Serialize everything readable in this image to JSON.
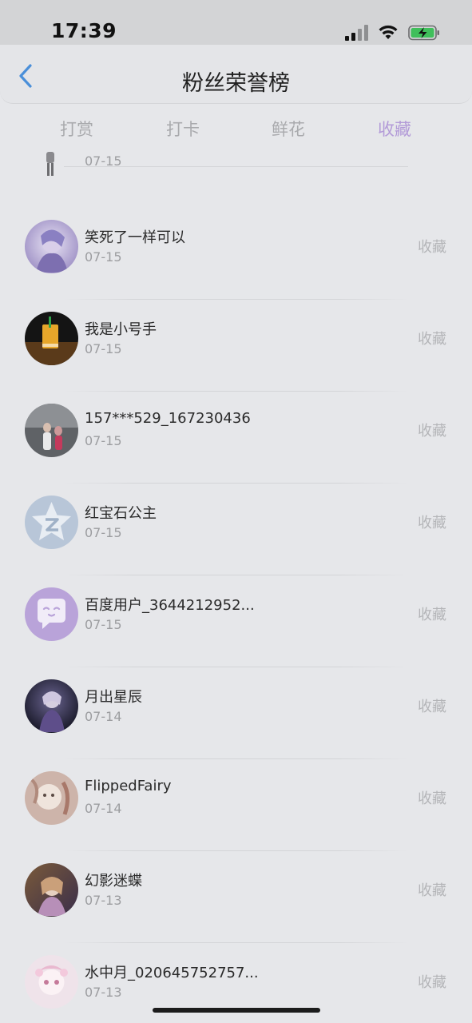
{
  "status_bar": {
    "time": "17:39"
  },
  "header": {
    "title": "粉丝荣誉榜"
  },
  "tabs": [
    {
      "label": "打赏",
      "active": false
    },
    {
      "label": "打卡",
      "active": false
    },
    {
      "label": "鲜花",
      "active": false
    },
    {
      "label": "收藏",
      "active": true
    }
  ],
  "partial_row": {
    "date": "07-15"
  },
  "fans": [
    {
      "name": "笑死了一样可以",
      "date": "07-15",
      "action": "收藏"
    },
    {
      "name": "我是小号手",
      "date": "07-15",
      "action": "收藏"
    },
    {
      "name": "157***529_167230436",
      "date": "07-15",
      "action": "收藏"
    },
    {
      "name": "红宝石公主",
      "date": "07-15",
      "action": "收藏"
    },
    {
      "name": "百度用户_3644212952...",
      "date": "07-15",
      "action": "收藏"
    },
    {
      "name": "月出星辰",
      "date": "07-14",
      "action": "收藏"
    },
    {
      "name": "FlippedFairy",
      "date": "07-14",
      "action": "收藏"
    },
    {
      "name": "幻影迷蝶",
      "date": "07-13",
      "action": "收藏"
    },
    {
      "name": "水中月_020645752757...",
      "date": "07-13",
      "action": "收藏"
    }
  ],
  "colors": {
    "accent": "#b39bd8",
    "back_arrow": "#4a8fd9"
  }
}
